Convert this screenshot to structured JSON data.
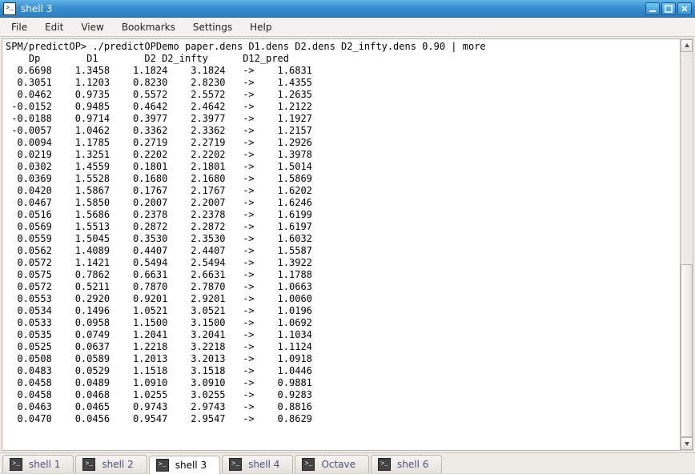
{
  "window": {
    "title": "shell 3"
  },
  "menu": {
    "items": [
      "File",
      "Edit",
      "View",
      "Bookmarks",
      "Settings",
      "Help"
    ]
  },
  "terminal": {
    "prompt": "SPM/predictOP> ",
    "command": "./predictOPDemo paper.dens D1.dens D2.dens D2_infty.dens 0.90 | more",
    "headers": [
      "Dp",
      "D1",
      "D2",
      "D2_infty",
      "D12_pred"
    ],
    "arrow": "->",
    "rows": [
      [
        "0.6698",
        "1.3458",
        "1.1824",
        "3.1824",
        "1.6831"
      ],
      [
        "0.3051",
        "1.1203",
        "0.8230",
        "2.8230",
        "1.4355"
      ],
      [
        "0.0462",
        "0.9735",
        "0.5572",
        "2.5572",
        "1.2635"
      ],
      [
        "-0.0152",
        "0.9485",
        "0.4642",
        "2.4642",
        "1.2122"
      ],
      [
        "-0.0188",
        "0.9714",
        "0.3977",
        "2.3977",
        "1.1927"
      ],
      [
        "-0.0057",
        "1.0462",
        "0.3362",
        "2.3362",
        "1.2157"
      ],
      [
        "0.0094",
        "1.1785",
        "0.2719",
        "2.2719",
        "1.2926"
      ],
      [
        "0.0219",
        "1.3251",
        "0.2202",
        "2.2202",
        "1.3978"
      ],
      [
        "0.0302",
        "1.4559",
        "0.1801",
        "2.1801",
        "1.5014"
      ],
      [
        "0.0369",
        "1.5528",
        "0.1680",
        "2.1680",
        "1.5869"
      ],
      [
        "0.0420",
        "1.5867",
        "0.1767",
        "2.1767",
        "1.6202"
      ],
      [
        "0.0467",
        "1.5850",
        "0.2007",
        "2.2007",
        "1.6246"
      ],
      [
        "0.0516",
        "1.5686",
        "0.2378",
        "2.2378",
        "1.6199"
      ],
      [
        "0.0569",
        "1.5513",
        "0.2872",
        "2.2872",
        "1.6197"
      ],
      [
        "0.0559",
        "1.5045",
        "0.3530",
        "2.3530",
        "1.6032"
      ],
      [
        "0.0562",
        "1.4089",
        "0.4407",
        "2.4407",
        "1.5587"
      ],
      [
        "0.0572",
        "1.1421",
        "0.5494",
        "2.5494",
        "1.3922"
      ],
      [
        "0.0575",
        "0.7862",
        "0.6631",
        "2.6631",
        "1.1788"
      ],
      [
        "0.0572",
        "0.5211",
        "0.7870",
        "2.7870",
        "1.0663"
      ],
      [
        "0.0553",
        "0.2920",
        "0.9201",
        "2.9201",
        "1.0060"
      ],
      [
        "0.0534",
        "0.1496",
        "1.0521",
        "3.0521",
        "1.0196"
      ],
      [
        "0.0533",
        "0.0958",
        "1.1500",
        "3.1500",
        "1.0692"
      ],
      [
        "0.0535",
        "0.0749",
        "1.2041",
        "3.2041",
        "1.1034"
      ],
      [
        "0.0525",
        "0.0637",
        "1.2218",
        "3.2218",
        "1.1124"
      ],
      [
        "0.0508",
        "0.0589",
        "1.2013",
        "3.2013",
        "1.0918"
      ],
      [
        "0.0483",
        "0.0529",
        "1.1518",
        "3.1518",
        "1.0446"
      ],
      [
        "0.0458",
        "0.0489",
        "1.0910",
        "3.0910",
        "0.9881"
      ],
      [
        "0.0458",
        "0.0468",
        "1.0255",
        "3.0255",
        "0.9283"
      ],
      [
        "0.0463",
        "0.0465",
        "0.9743",
        "2.9743",
        "0.8816"
      ],
      [
        "0.0470",
        "0.0456",
        "0.9547",
        "2.9547",
        "0.8629"
      ]
    ]
  },
  "tabs": {
    "items": [
      "shell 1",
      "shell 2",
      "shell 3",
      "shell 4",
      "Octave",
      "shell 6"
    ],
    "active_index": 2
  }
}
